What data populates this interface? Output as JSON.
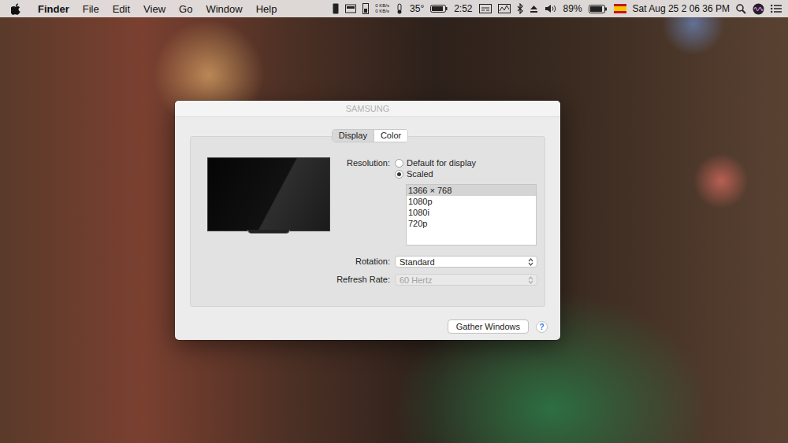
{
  "menu_bar": {
    "app": "Finder",
    "menus": [
      "File",
      "Edit",
      "View",
      "Go",
      "Window",
      "Help"
    ],
    "status": {
      "upload": "0 KB/s",
      "download": "0 KB/s",
      "temperature": "35°",
      "battery_time": "2:52",
      "battery_percent": "89%",
      "battery_level": 0.89,
      "clock": "Sat Aug 25  2 06 36 PM"
    }
  },
  "window": {
    "title": "SAMSUNG"
  },
  "tabs": [
    {
      "label": "Display",
      "selected": true
    },
    {
      "label": "Color",
      "selected": false
    }
  ],
  "resolution": {
    "label": "Resolution:",
    "options": [
      {
        "label": "Default for display",
        "selected": false
      },
      {
        "label": "Scaled",
        "selected": true
      }
    ],
    "modes": [
      {
        "label": "1366 × 768",
        "selected": true
      },
      {
        "label": "1080p",
        "selected": false
      },
      {
        "label": "1080i",
        "selected": false
      },
      {
        "label": "720p",
        "selected": false
      }
    ]
  },
  "rotation": {
    "label": "Rotation:",
    "value": "Standard",
    "disabled": false
  },
  "refresh_rate": {
    "label": "Refresh Rate:",
    "value": "60 Hertz",
    "disabled": true
  },
  "buttons": {
    "gather": "Gather Windows",
    "help": "?"
  }
}
